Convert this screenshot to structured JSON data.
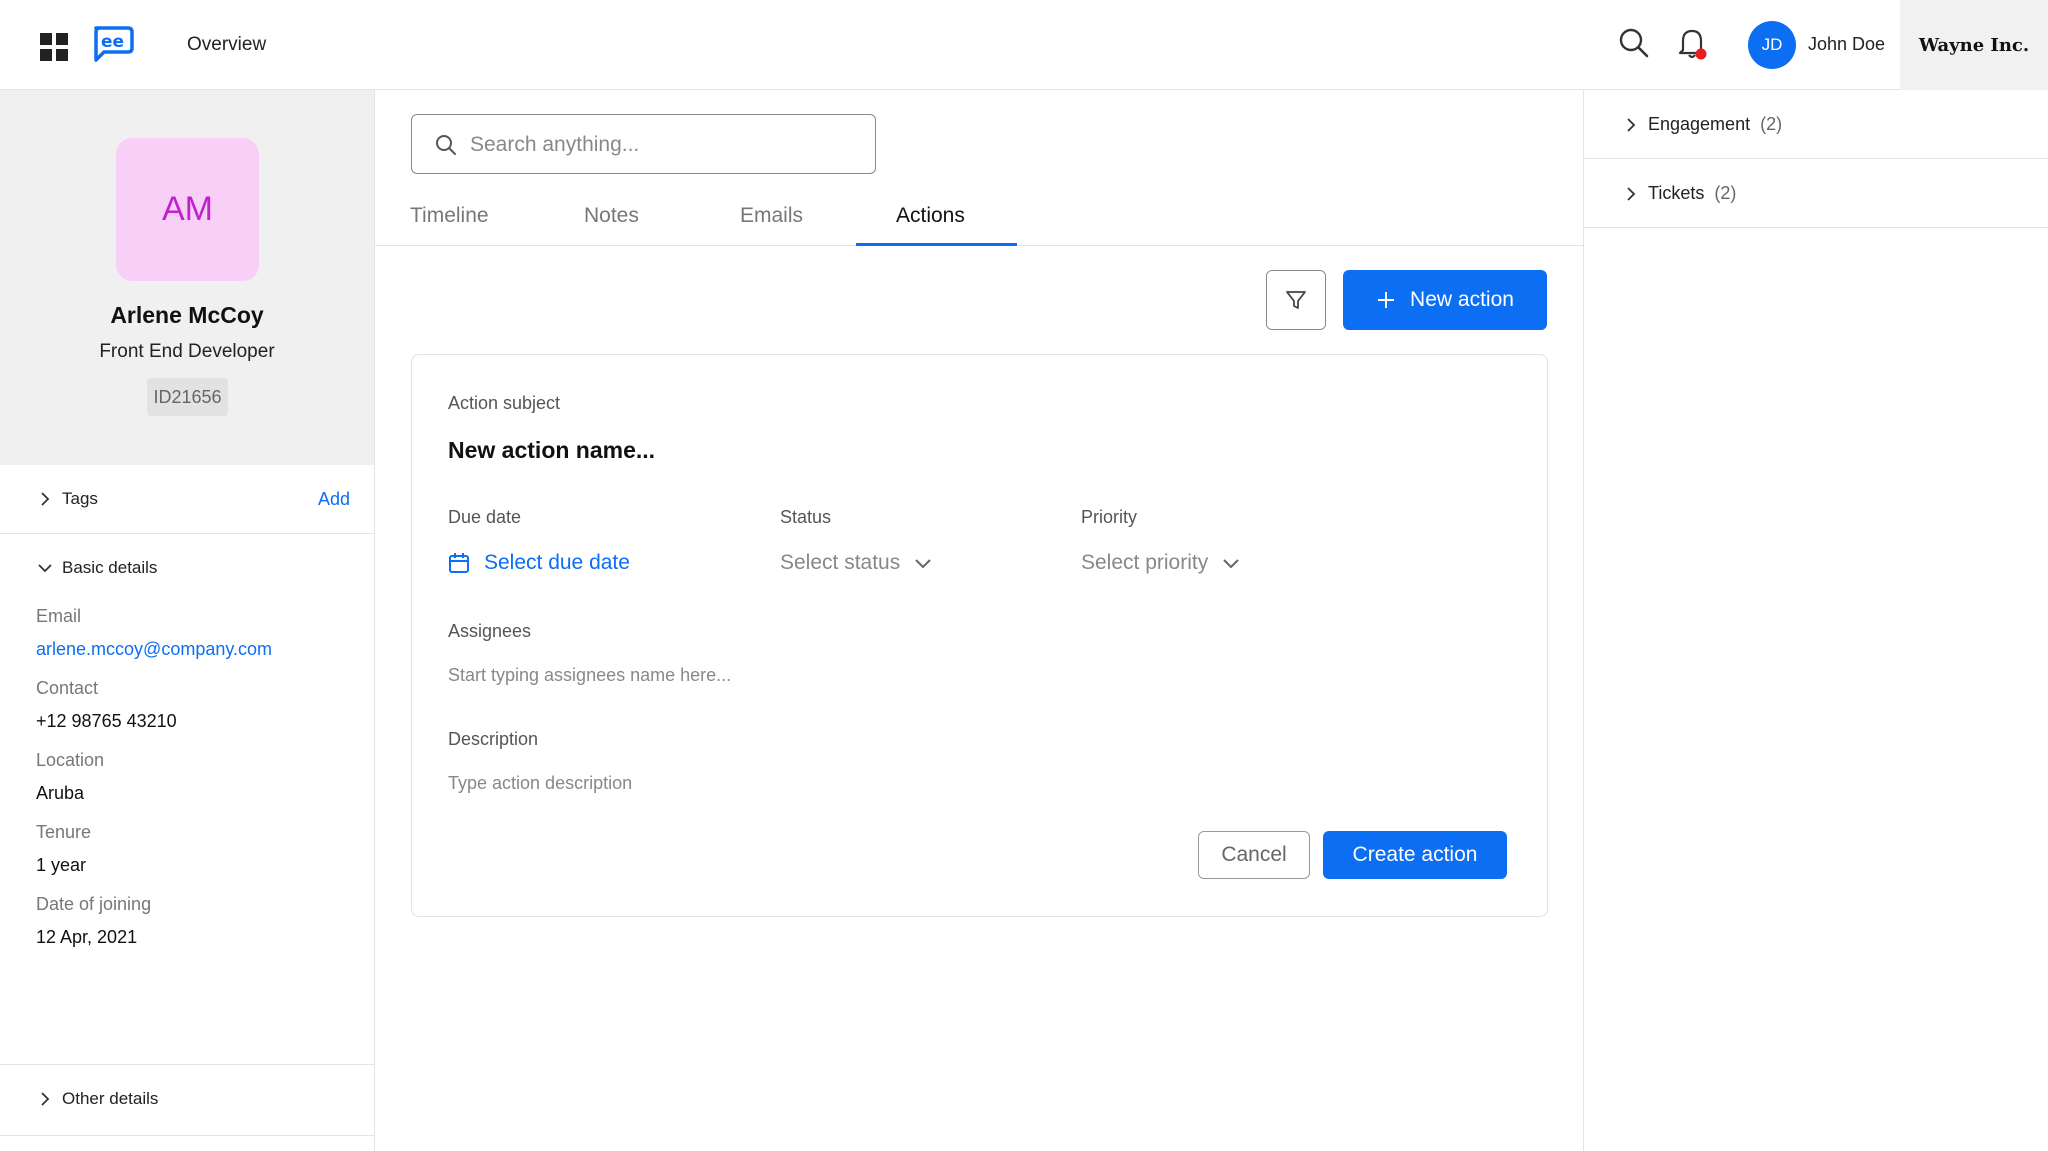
{
  "header": {
    "nav_label": "Overview",
    "user": {
      "initials": "JD",
      "name": "John Doe"
    },
    "organization": "Wayne Inc.",
    "colors": {
      "accent": "#0b6ef3",
      "notification_dot": "#e81c1c"
    }
  },
  "profile": {
    "initials": "AM",
    "name": "Arlene McCoy",
    "role": "Front End Developer",
    "id": "ID21656",
    "avatar_bg": "#f8d0f7",
    "avatar_fg": "#c020cd"
  },
  "tags_section": {
    "title": "Tags",
    "add_label": "Add"
  },
  "basic_details": {
    "title": "Basic details",
    "fields": [
      {
        "label": "Email",
        "value": "arlene.mccoy@company.com"
      },
      {
        "label": "Contact",
        "value": "+12 98765 43210"
      },
      {
        "label": "Location",
        "value": "Aruba"
      },
      {
        "label": "Tenure",
        "value": "1 year"
      },
      {
        "label": "Date of joining",
        "value": "12 Apr, 2021"
      }
    ]
  },
  "other_details": {
    "title": "Other details"
  },
  "search": {
    "placeholder": "Search anything..."
  },
  "tabs": [
    {
      "label": "Timeline"
    },
    {
      "label": "Notes"
    },
    {
      "label": "Emails"
    },
    {
      "label": "Actions",
      "active": true
    }
  ],
  "toolbar": {
    "new_action_label": "New action"
  },
  "action_form": {
    "subject_label": "Action subject",
    "subject_value": "New action name...",
    "due_date_label": "Due date",
    "due_date_value": "Select due date",
    "status_label": "Status",
    "status_value": "Select status",
    "priority_label": "Priority",
    "priority_value": "Select priority",
    "assignees_label": "Assignees",
    "assignees_placeholder": "Start typing assignees name here...",
    "description_label": "Description",
    "description_placeholder": "Type action description",
    "cancel_label": "Cancel",
    "create_label": "Create action"
  },
  "right_panel": [
    {
      "title": "Engagement",
      "count": "(2)"
    },
    {
      "title": "Tickets",
      "count": "(2)"
    }
  ],
  "icons": [
    "apps-grid-icon",
    "chat-logo-icon",
    "search-icon",
    "bell-icon",
    "chevron-right-icon",
    "chevron-down-icon",
    "filter-icon",
    "plus-icon",
    "calendar-icon"
  ]
}
